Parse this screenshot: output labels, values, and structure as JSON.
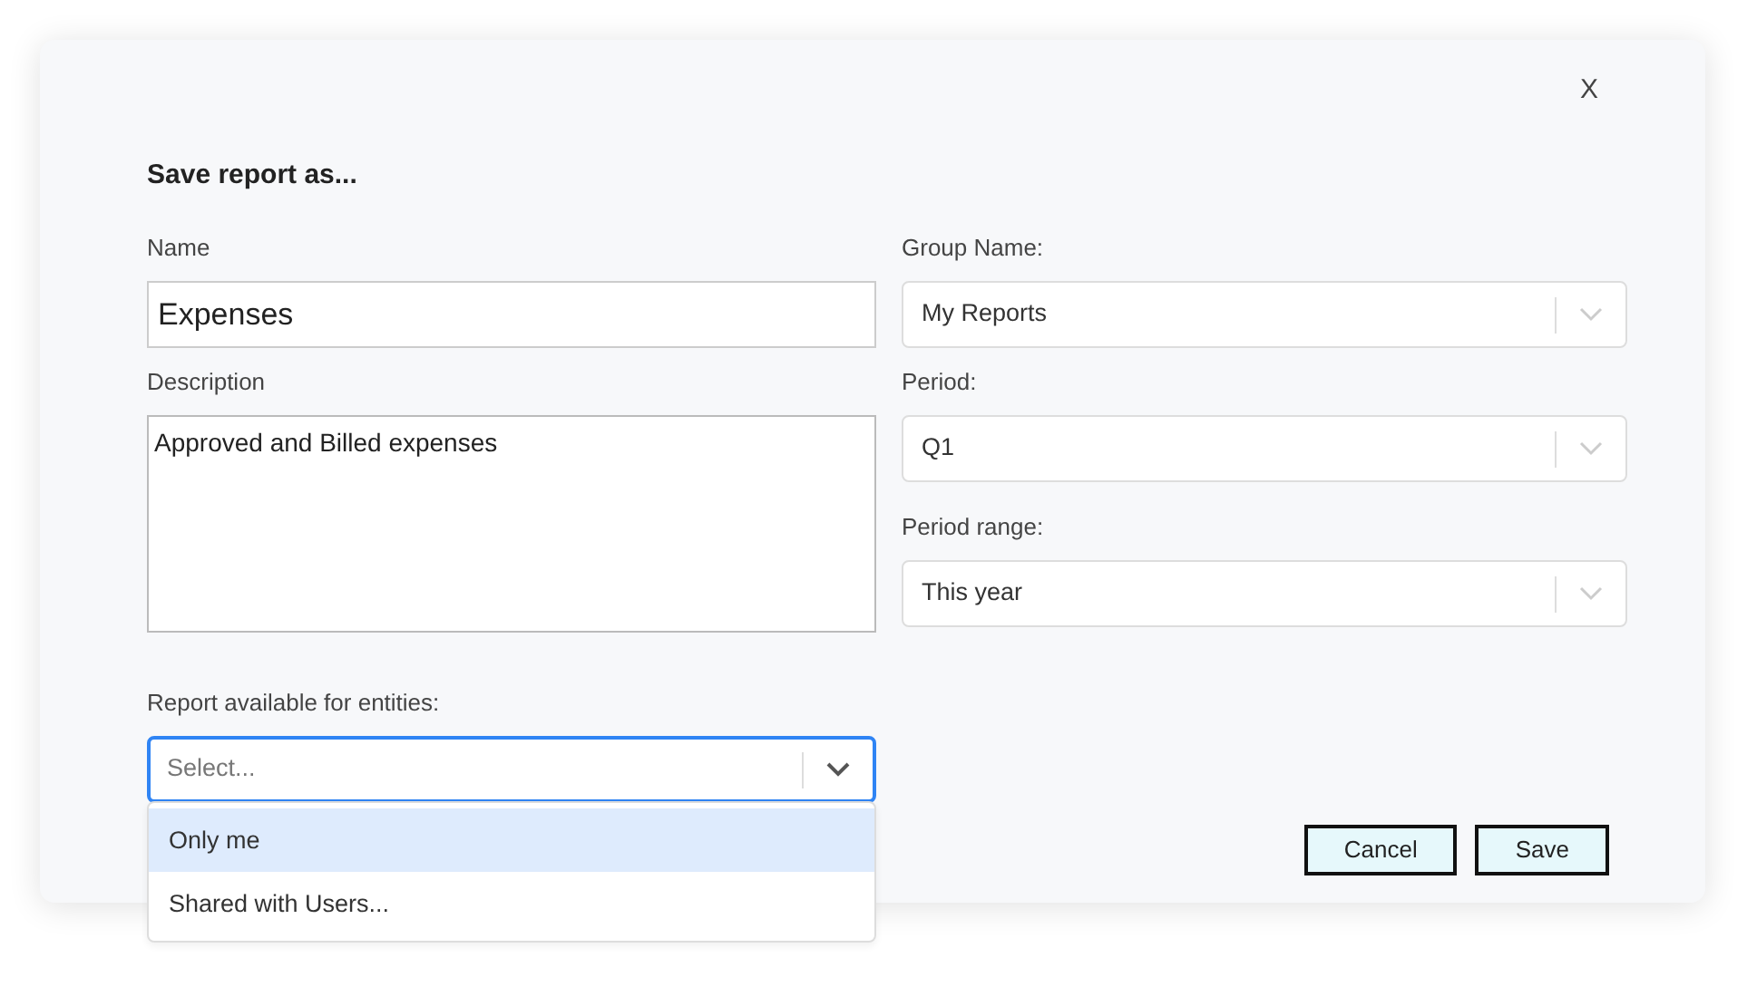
{
  "dialog": {
    "close": "X",
    "title": "Save report as..."
  },
  "left_fields": [
    {
      "kind": "text",
      "label": "Name",
      "value": "Expenses"
    },
    {
      "kind": "textarea",
      "label": "Description",
      "value": "Approved and Billed expenses"
    },
    {
      "kind": "select",
      "label": "Report available for entities:",
      "placeholder": "Select...",
      "focused": true,
      "options": [
        {
          "label": "Only me",
          "highlighted": true
        },
        {
          "label": "Shared with Users...",
          "highlighted": false
        }
      ]
    }
  ],
  "right_fields": [
    {
      "kind": "select",
      "label": "Group Name:",
      "value": "My Reports",
      "focused": false
    },
    {
      "kind": "select",
      "label": "Period:",
      "value": "Q1",
      "focused": false
    },
    {
      "kind": "select",
      "label": "Period range:",
      "value": "This year",
      "focused": false
    }
  ],
  "buttons": [
    {
      "label": "Cancel"
    },
    {
      "label": "Save"
    }
  ]
}
